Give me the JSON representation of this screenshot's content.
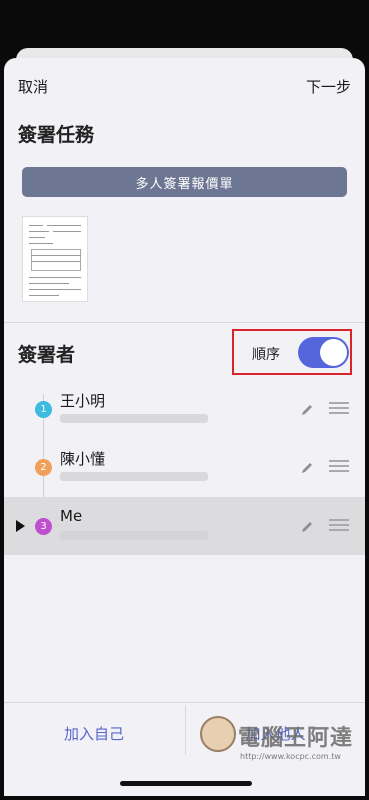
{
  "nav": {
    "cancel_label": "取消",
    "next_label": "下一步"
  },
  "task": {
    "title": "簽署任務",
    "document_name": "多人簽署報價單"
  },
  "signers": {
    "title": "簽署者",
    "order_label": "順序",
    "order_enabled": true,
    "toggle_color": "#5566dd",
    "items": [
      {
        "number": "1",
        "name": "王小明",
        "badge_color": "#3bbbe0",
        "active": false
      },
      {
        "number": "2",
        "name": "陳小懂",
        "badge_color": "#f0a05a",
        "active": false
      },
      {
        "number": "3",
        "name": "Me",
        "badge_color": "#c04fd0",
        "active": true
      }
    ]
  },
  "footer": {
    "add_self_label": "加入自己",
    "add_others_label": "加入他人",
    "accent_color": "#5566cc"
  },
  "watermark": {
    "title": "電腦王阿達",
    "url": "http://www.kocpc.com.tw"
  }
}
